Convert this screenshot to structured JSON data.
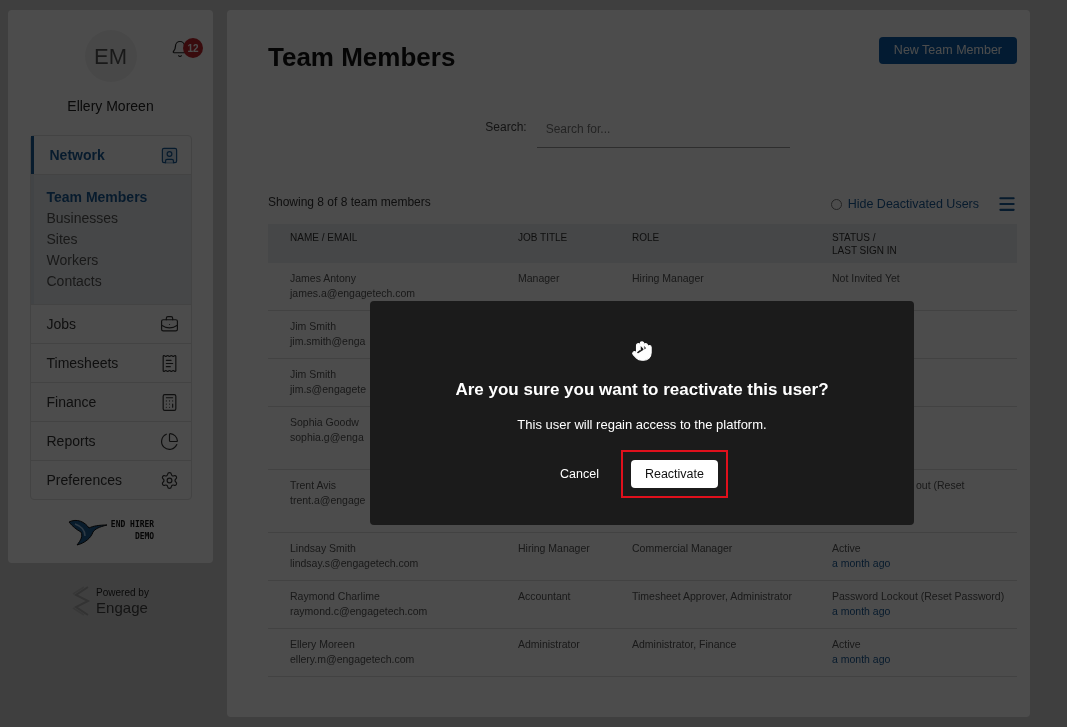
{
  "user": {
    "initials": "EM",
    "name": "Ellery Moreen",
    "notifications": "12"
  },
  "nav": [
    {
      "label": "Network",
      "kind": "group",
      "selected": true,
      "children": [
        {
          "label": "Team Members",
          "selected": true
        },
        {
          "label": "Businesses",
          "selected": false
        },
        {
          "label": "Sites",
          "selected": false
        },
        {
          "label": "Workers",
          "selected": false
        },
        {
          "label": "Contacts",
          "selected": false
        }
      ]
    },
    {
      "label": "Jobs",
      "kind": "jobs",
      "selected": false
    },
    {
      "label": "Timesheets",
      "kind": "timesheets",
      "selected": false
    },
    {
      "label": "Finance",
      "kind": "finance",
      "selected": false
    },
    {
      "label": "Reports",
      "kind": "reports",
      "selected": false
    },
    {
      "label": "Preferences",
      "kind": "preferences",
      "selected": false
    }
  ],
  "brand": {
    "line_1": "END HIRER",
    "line_2": "DEMO"
  },
  "powered_by": {
    "caption": "Powered by",
    "name": "Engage"
  },
  "page": {
    "title": "Team Members",
    "new_button": "New Team Member",
    "search_label": "Search:",
    "search_placeholder": "Search for...",
    "summary": "Showing 8 of 8 team members",
    "hide_deactivated": {
      "label": "Hide Deactivated Users",
      "checked": false
    }
  },
  "table": {
    "columns": [
      "NAME / EMAIL",
      "JOB TITLE",
      "ROLE",
      "STATUS /\nLAST SIGN IN"
    ],
    "rows": [
      {
        "name": "James Antony",
        "email": "james.a@engagetech.com",
        "job_title": "Manager",
        "role": "Hiring Manager",
        "status": "Not Invited Yet"
      },
      {
        "name": "Jim Smith",
        "email": "jim.smith@enga"
      },
      {
        "name": "Jim Smith",
        "email": "jim.s@engagete"
      },
      {
        "name": "Sophia Goodw",
        "email": "sophia.g@enga",
        "tall": true
      },
      {
        "name": "Trent Avis",
        "email": "trent.a@engage",
        "status": "out (Reset",
        "status_partial": true,
        "tall": true
      },
      {
        "name": "Lindsay Smith",
        "email": "lindsay.s@engagetech.com",
        "job_title": "Hiring Manager",
        "role": "Commercial Manager",
        "status": "Active",
        "last_sign_in": "a month ago"
      },
      {
        "name": "Raymond Charlime",
        "email": "raymond.c@engagetech.com",
        "job_title": "Accountant",
        "role": "Timesheet Approver, Administrator",
        "status": "Password Lockout (Reset Password)",
        "last_sign_in": "a month ago"
      },
      {
        "name": "Ellery Moreen",
        "email": "ellery.m@engagetech.com",
        "job_title": "Administrator",
        "role": "Administrator, Finance",
        "status": "Active",
        "last_sign_in": "a month ago"
      }
    ]
  },
  "dialog": {
    "title": "Are you sure you want to reactivate this user?",
    "message": "This user will regain access to the platform.",
    "cancel": "Cancel",
    "confirm": "Reactivate",
    "confirm_highlighted": true
  }
}
